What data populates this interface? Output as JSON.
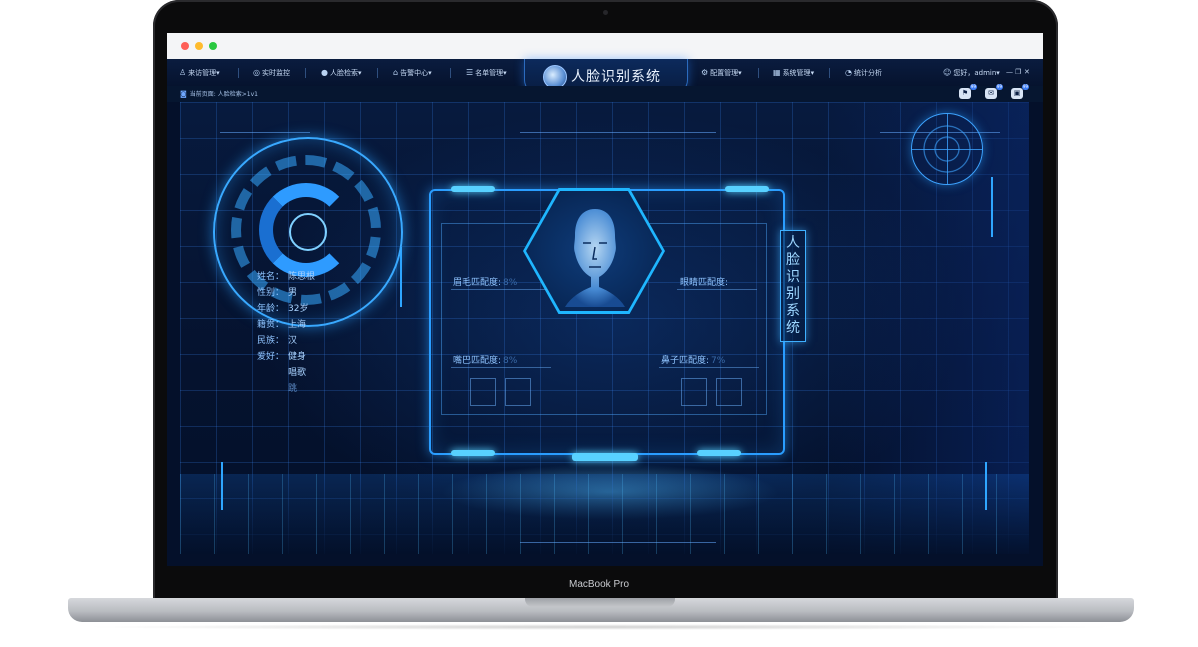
{
  "device": {
    "label": "MacBook Pro"
  },
  "app": {
    "title": "人脸识别系统",
    "nav": [
      {
        "label": "来访管理",
        "icon": "user-icon",
        "dropdown": true
      },
      {
        "label": "实时监控",
        "icon": "camera-icon",
        "dropdown": false
      },
      {
        "label": "人脸检索",
        "icon": "person-icon",
        "dropdown": true
      },
      {
        "label": "告警中心",
        "icon": "bank-icon",
        "dropdown": true
      },
      {
        "label": "名单管理",
        "icon": "list-icon",
        "dropdown": true
      },
      {
        "label": "配置管理",
        "icon": "settings-icon",
        "dropdown": true
      },
      {
        "label": "系统管理",
        "icon": "grid-icon",
        "dropdown": true
      },
      {
        "label": "统计分析",
        "icon": "pie-icon",
        "dropdown": false
      }
    ],
    "user": {
      "greeting": "您好，admin",
      "icon": "avatar-icon"
    },
    "window_controls": [
      "—",
      "❐",
      "✕"
    ]
  },
  "breadcrumb": {
    "prefix": "当前页面:",
    "path": "人脸检索>1v1"
  },
  "toolbar": {
    "badges": [
      "99",
      "99",
      "99"
    ],
    "icons": [
      "alert-icon",
      "message-icon",
      "monitor-icon"
    ]
  },
  "profile": {
    "rows": [
      {
        "key": "姓名：",
        "value": "陈思根"
      },
      {
        "key": "性别：",
        "value": "男"
      },
      {
        "key": "年龄：",
        "value": "32岁"
      },
      {
        "key": "籍贯：",
        "value": "上海"
      },
      {
        "key": "民族：",
        "value": "汉"
      },
      {
        "key": "爱好：",
        "value": "健身"
      }
    ],
    "hobby_extra": [
      "唱歌",
      "跳"
    ]
  },
  "metrics": {
    "eyebrow": {
      "label": "眉毛匹配度:",
      "value": "8%"
    },
    "eyes": {
      "label": "眼睛匹配度:",
      "value": ""
    },
    "mouth": {
      "label": "嘴巴匹配度:",
      "value": "8%"
    },
    "nose": {
      "label": "鼻子匹配度:",
      "value": "7%"
    }
  },
  "side_title": [
    "人",
    "脸",
    "识",
    "别",
    "系",
    "统"
  ],
  "colors": {
    "accent": "#2a9dff",
    "glow": "#58d1ff",
    "nav_bg": "#0a1c3f",
    "stage_bg": "#05122e"
  }
}
